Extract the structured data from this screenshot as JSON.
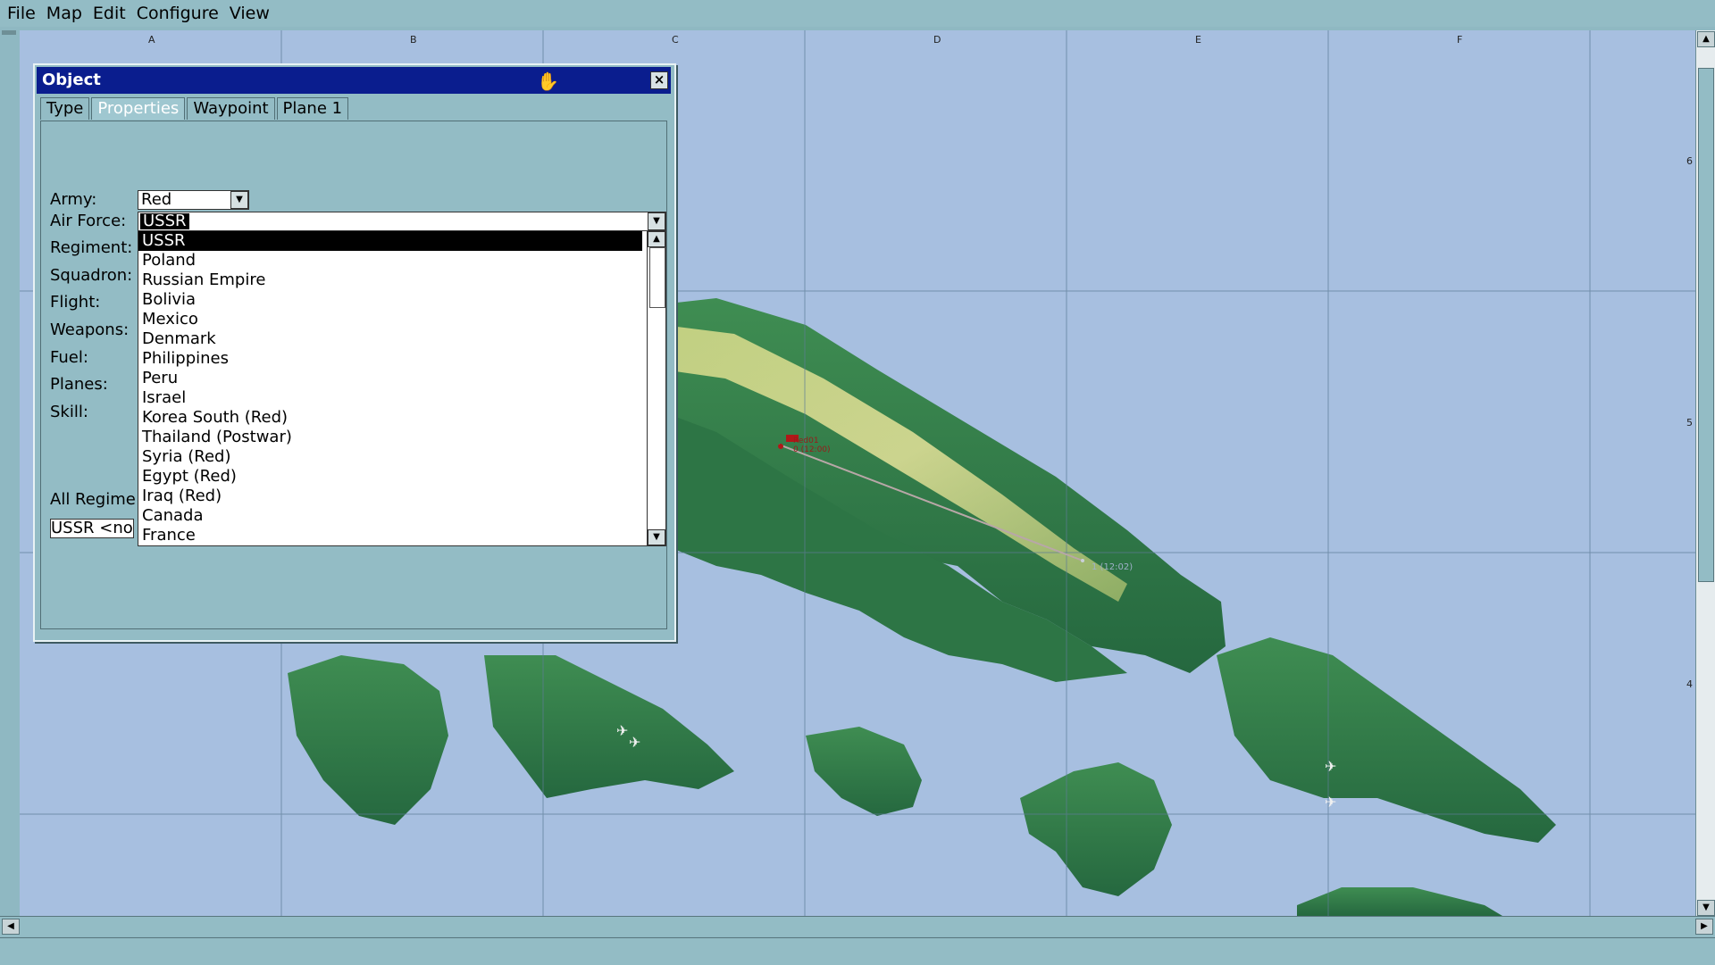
{
  "menu": [
    "File",
    "Map",
    "Edit",
    "Configure",
    "View"
  ],
  "grid": {
    "columns": [
      "A",
      "B",
      "C",
      "D",
      "E",
      "F"
    ],
    "rows": [
      "6",
      "5",
      "4"
    ]
  },
  "map": {
    "waypoint_start_label": "Red01",
    "waypoint_start_sub": "0 (12:00)",
    "waypoint_end_label": "1 (12:02)"
  },
  "dialog": {
    "title": "Object",
    "tabs": [
      "Type",
      "Properties",
      "Waypoint",
      "Plane 1"
    ],
    "active_tab": "Properties",
    "labels": {
      "army": "Army:",
      "air_force": "Air Force:",
      "regiment": "Regiment:",
      "squadron": "Squadron:",
      "flight": "Flight:",
      "weapons": "Weapons:",
      "fuel": "Fuel:",
      "planes": "Planes:",
      "skill": "Skill:",
      "all_regiments": "All Regime"
    },
    "army_value": "Red",
    "air_force_value": "USSR",
    "regiments_input_value": "USSR <no",
    "air_force_options": [
      "USSR",
      "Poland",
      "Russian Empire",
      "Bolivia",
      "Mexico",
      "Denmark",
      "Philippines",
      "Peru",
      "Israel",
      "Korea South (Red)",
      "Thailand (Postwar)",
      "Syria (Red)",
      "Egypt (Red)",
      "Iraq (Red)",
      "Canada",
      "France"
    ],
    "selected_option": "USSR"
  },
  "colors": {
    "title_bar": "#0a1d8e",
    "dialog_bg": "#93bcc5",
    "sea": "#a7bfe0",
    "land": "#2f7a4a",
    "ridge": "#d6d67a"
  }
}
